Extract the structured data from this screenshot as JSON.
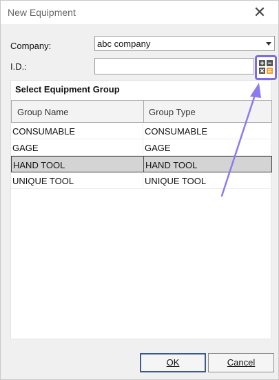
{
  "window": {
    "title": "New Equipment",
    "close_icon": "close-icon"
  },
  "form": {
    "company_label": "Company:",
    "company_value": "abc company",
    "id_label": "I.D.:",
    "id_value": "",
    "calculator_icon": "calculator-icon"
  },
  "group": {
    "header": "Select Equipment Group",
    "columns": [
      "Group Name",
      "Group Type"
    ],
    "rows": [
      {
        "name": "CONSUMABLE",
        "type": "CONSUMABLE"
      },
      {
        "name": "GAGE",
        "type": "GAGE"
      },
      {
        "name": "HAND TOOL",
        "type": "HAND TOOL"
      },
      {
        "name": "UNIQUE TOOL",
        "type": "UNIQUE TOOL"
      }
    ],
    "selected_row": "HAND TOOL"
  },
  "buttons": {
    "ok": "OK",
    "cancel": "Cancel"
  },
  "colors": {
    "highlight": "#7b6be6",
    "ok_border": "#3c5a8a",
    "calc_orange": "#f0a030",
    "calc_dark": "#555555"
  }
}
